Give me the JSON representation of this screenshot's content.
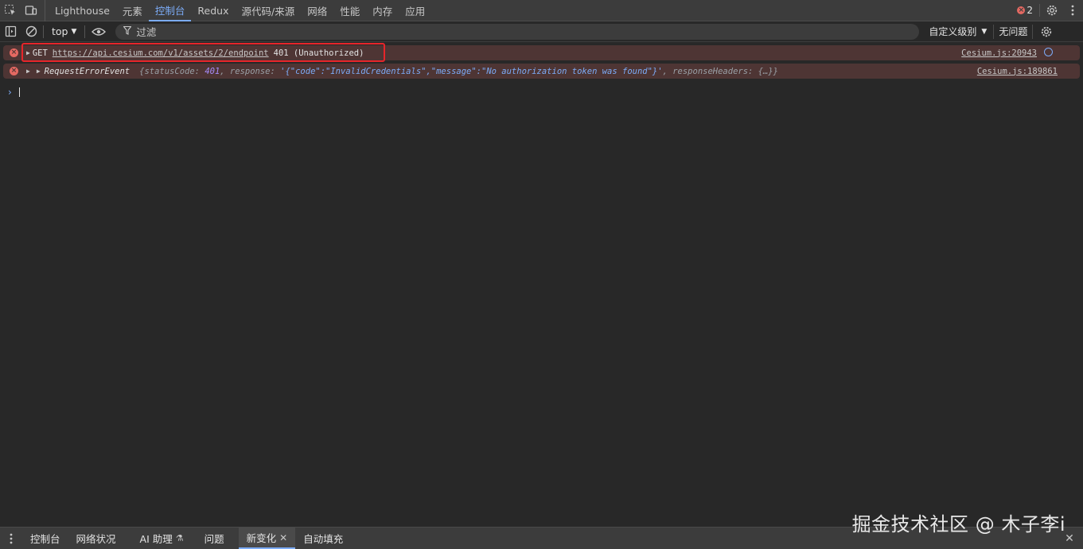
{
  "panel_tabs": [
    "Lighthouse",
    "元素",
    "控制台",
    "Redux",
    "源代码/来源",
    "网络",
    "性能",
    "内存",
    "应用"
  ],
  "error_count": "2",
  "toolbar": {
    "context": "top",
    "filter_placeholder": "过滤",
    "levels": "自定义级别",
    "issues": "无问题"
  },
  "messages": {
    "m1": {
      "method": "GET",
      "url": "https://api.cesium.com/v1/assets/2/endpoint",
      "status": "401 (Unauthorized)",
      "source": "Cesium.js:20943"
    },
    "m2": {
      "event": "RequestErrorEvent",
      "body_start": "{statusCode: ",
      "status_code": "401",
      "body_mid": ", response: ",
      "response": "'{\"code\":\"InvalidCredentials\",\"message\":\"No authorization token was found\"}'",
      "body_end": ", responseHeaders: {…}}",
      "source": "Cesium.js:189861"
    }
  },
  "drawer_tabs": {
    "console": "控制台",
    "network_conditions": "网络状况",
    "ai_assistant": "AI 助理",
    "issues": "问题",
    "changes": "新变化",
    "autofill": "自动填充"
  },
  "watermark": "掘金技术社区 @ 木子李i",
  "colors": {
    "accent": "#7cacf8",
    "error": "#e46962",
    "error_row_bg": "#4e3534",
    "highlight_box": "#e8252a"
  }
}
